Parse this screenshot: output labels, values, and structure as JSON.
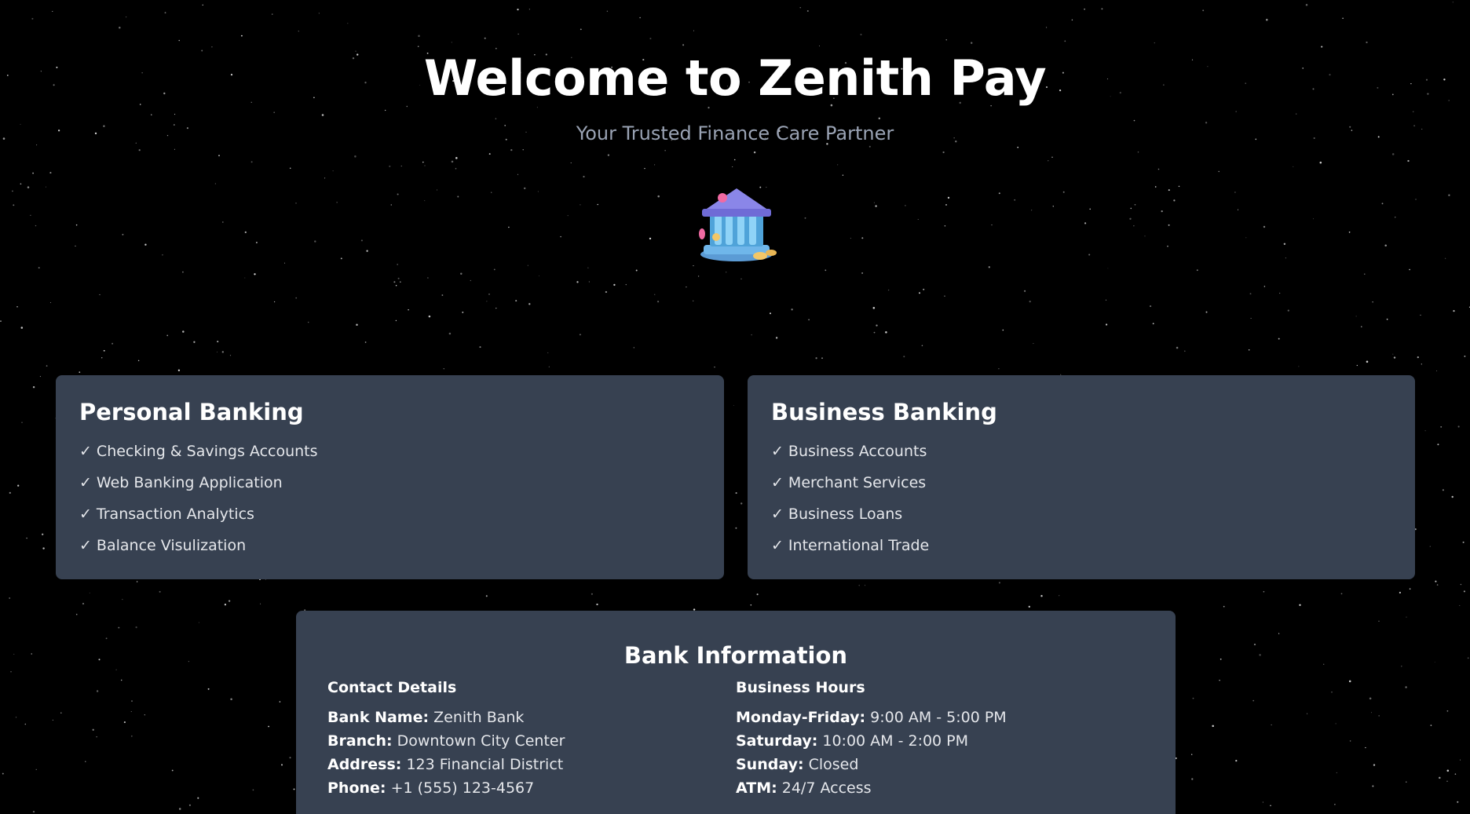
{
  "hero": {
    "title": "Welcome to Zenith Pay",
    "subtitle": "Your Trusted Finance Care Partner",
    "icon": "bank-building-icon"
  },
  "personal": {
    "title": "Personal Banking",
    "check": "✓",
    "items": [
      "Checking & Savings Accounts",
      "Web Banking Application",
      "Transaction Analytics",
      "Balance Visulization"
    ]
  },
  "business": {
    "title": "Business Banking",
    "check": "✓",
    "items": [
      "Business Accounts",
      "Merchant Services",
      "Business Loans",
      "International Trade"
    ]
  },
  "info": {
    "title": "Bank Information",
    "contact": {
      "heading": "Contact Details",
      "rows": [
        {
          "label": "Bank Name:",
          "value": "Zenith Bank"
        },
        {
          "label": "Branch:",
          "value": "Downtown City Center"
        },
        {
          "label": "Address:",
          "value": "123 Financial District"
        },
        {
          "label": "Phone:",
          "value": "+1 (555) 123-4567"
        }
      ]
    },
    "hours": {
      "heading": "Business Hours",
      "rows": [
        {
          "label": "Monday-Friday:",
          "value": "9:00 AM - 5:00 PM"
        },
        {
          "label": "Saturday:",
          "value": "10:00 AM - 2:00 PM"
        },
        {
          "label": "Sunday:",
          "value": "Closed"
        },
        {
          "label": "ATM:",
          "value": "24/7 Access"
        }
      ]
    }
  },
  "colors": {
    "background": "#000000",
    "card": "#374151",
    "subtitle": "#9aa3b4"
  }
}
